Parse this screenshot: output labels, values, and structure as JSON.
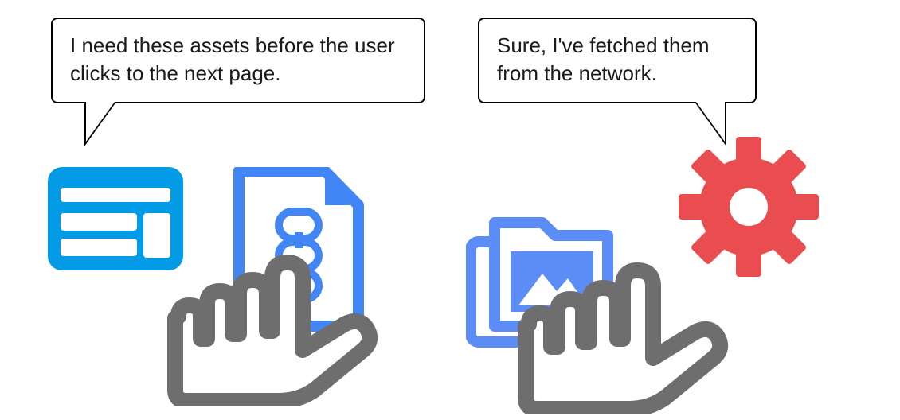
{
  "bubbles": {
    "left": "I need these assets before the user clicks to the next page.",
    "right": "Sure, I've fetched them from the network."
  },
  "colors": {
    "browser_blue": "#039BE5",
    "doc_blue": "#4285F4",
    "folder_blue": "#5C8DF6",
    "gear_red": "#EA4D50",
    "hand_gray": "#6E6E6E",
    "white": "#FFFFFF",
    "black": "#000000"
  },
  "icons": {
    "browser": "browser-window-icon",
    "document": "linked-document-icon",
    "hand_left": "hand-pointing-icon",
    "folder": "image-folder-icon",
    "hand_right": "hand-pointing-icon",
    "gear": "gear-settings-icon"
  }
}
